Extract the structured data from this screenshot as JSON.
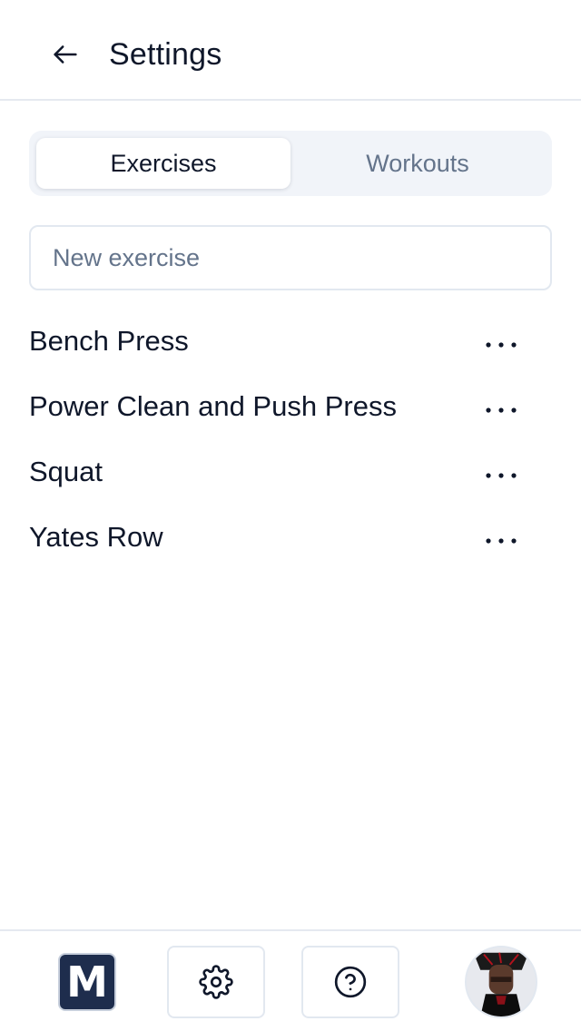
{
  "header": {
    "back_icon": "arrow-left-icon",
    "title": "Settings"
  },
  "tabs": [
    {
      "label": "Exercises",
      "active": true
    },
    {
      "label": "Workouts",
      "active": false
    }
  ],
  "new_exercise": {
    "placeholder": "New exercise",
    "value": ""
  },
  "exercises": [
    {
      "name": "Bench Press",
      "menu_icon": "more-horizontal-icon"
    },
    {
      "name": "Power Clean and Push Press",
      "menu_icon": "more-horizontal-icon"
    },
    {
      "name": "Squat",
      "menu_icon": "more-horizontal-icon"
    },
    {
      "name": "Yates Row",
      "menu_icon": "more-horizontal-icon"
    }
  ],
  "bottom_nav": {
    "logo_letter": "M",
    "settings_icon": "gear-icon",
    "help_icon": "help-circle-icon",
    "avatar_icon": "user-avatar"
  },
  "colors": {
    "text": "#0f172a",
    "muted": "#64748b",
    "tab_bg": "#f1f4f9",
    "border": "#e2e8f0",
    "logo_bg": "#1e2d4d"
  }
}
